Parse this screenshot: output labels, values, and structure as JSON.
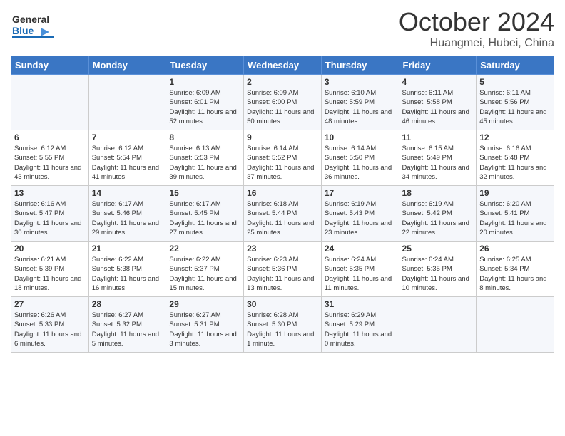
{
  "header": {
    "logo_general": "General",
    "logo_blue": "Blue",
    "month_title": "October 2024",
    "location": "Huangmei, Hubei, China"
  },
  "weekdays": [
    "Sunday",
    "Monday",
    "Tuesday",
    "Wednesday",
    "Thursday",
    "Friday",
    "Saturday"
  ],
  "weeks": [
    [
      {
        "day": "",
        "sunrise": "",
        "sunset": "",
        "daylight": ""
      },
      {
        "day": "",
        "sunrise": "",
        "sunset": "",
        "daylight": ""
      },
      {
        "day": "1",
        "sunrise": "Sunrise: 6:09 AM",
        "sunset": "Sunset: 6:01 PM",
        "daylight": "Daylight: 11 hours and 52 minutes."
      },
      {
        "day": "2",
        "sunrise": "Sunrise: 6:09 AM",
        "sunset": "Sunset: 6:00 PM",
        "daylight": "Daylight: 11 hours and 50 minutes."
      },
      {
        "day": "3",
        "sunrise": "Sunrise: 6:10 AM",
        "sunset": "Sunset: 5:59 PM",
        "daylight": "Daylight: 11 hours and 48 minutes."
      },
      {
        "day": "4",
        "sunrise": "Sunrise: 6:11 AM",
        "sunset": "Sunset: 5:58 PM",
        "daylight": "Daylight: 11 hours and 46 minutes."
      },
      {
        "day": "5",
        "sunrise": "Sunrise: 6:11 AM",
        "sunset": "Sunset: 5:56 PM",
        "daylight": "Daylight: 11 hours and 45 minutes."
      }
    ],
    [
      {
        "day": "6",
        "sunrise": "Sunrise: 6:12 AM",
        "sunset": "Sunset: 5:55 PM",
        "daylight": "Daylight: 11 hours and 43 minutes."
      },
      {
        "day": "7",
        "sunrise": "Sunrise: 6:12 AM",
        "sunset": "Sunset: 5:54 PM",
        "daylight": "Daylight: 11 hours and 41 minutes."
      },
      {
        "day": "8",
        "sunrise": "Sunrise: 6:13 AM",
        "sunset": "Sunset: 5:53 PM",
        "daylight": "Daylight: 11 hours and 39 minutes."
      },
      {
        "day": "9",
        "sunrise": "Sunrise: 6:14 AM",
        "sunset": "Sunset: 5:52 PM",
        "daylight": "Daylight: 11 hours and 37 minutes."
      },
      {
        "day": "10",
        "sunrise": "Sunrise: 6:14 AM",
        "sunset": "Sunset: 5:50 PM",
        "daylight": "Daylight: 11 hours and 36 minutes."
      },
      {
        "day": "11",
        "sunrise": "Sunrise: 6:15 AM",
        "sunset": "Sunset: 5:49 PM",
        "daylight": "Daylight: 11 hours and 34 minutes."
      },
      {
        "day": "12",
        "sunrise": "Sunrise: 6:16 AM",
        "sunset": "Sunset: 5:48 PM",
        "daylight": "Daylight: 11 hours and 32 minutes."
      }
    ],
    [
      {
        "day": "13",
        "sunrise": "Sunrise: 6:16 AM",
        "sunset": "Sunset: 5:47 PM",
        "daylight": "Daylight: 11 hours and 30 minutes."
      },
      {
        "day": "14",
        "sunrise": "Sunrise: 6:17 AM",
        "sunset": "Sunset: 5:46 PM",
        "daylight": "Daylight: 11 hours and 29 minutes."
      },
      {
        "day": "15",
        "sunrise": "Sunrise: 6:17 AM",
        "sunset": "Sunset: 5:45 PM",
        "daylight": "Daylight: 11 hours and 27 minutes."
      },
      {
        "day": "16",
        "sunrise": "Sunrise: 6:18 AM",
        "sunset": "Sunset: 5:44 PM",
        "daylight": "Daylight: 11 hours and 25 minutes."
      },
      {
        "day": "17",
        "sunrise": "Sunrise: 6:19 AM",
        "sunset": "Sunset: 5:43 PM",
        "daylight": "Daylight: 11 hours and 23 minutes."
      },
      {
        "day": "18",
        "sunrise": "Sunrise: 6:19 AM",
        "sunset": "Sunset: 5:42 PM",
        "daylight": "Daylight: 11 hours and 22 minutes."
      },
      {
        "day": "19",
        "sunrise": "Sunrise: 6:20 AM",
        "sunset": "Sunset: 5:41 PM",
        "daylight": "Daylight: 11 hours and 20 minutes."
      }
    ],
    [
      {
        "day": "20",
        "sunrise": "Sunrise: 6:21 AM",
        "sunset": "Sunset: 5:39 PM",
        "daylight": "Daylight: 11 hours and 18 minutes."
      },
      {
        "day": "21",
        "sunrise": "Sunrise: 6:22 AM",
        "sunset": "Sunset: 5:38 PM",
        "daylight": "Daylight: 11 hours and 16 minutes."
      },
      {
        "day": "22",
        "sunrise": "Sunrise: 6:22 AM",
        "sunset": "Sunset: 5:37 PM",
        "daylight": "Daylight: 11 hours and 15 minutes."
      },
      {
        "day": "23",
        "sunrise": "Sunrise: 6:23 AM",
        "sunset": "Sunset: 5:36 PM",
        "daylight": "Daylight: 11 hours and 13 minutes."
      },
      {
        "day": "24",
        "sunrise": "Sunrise: 6:24 AM",
        "sunset": "Sunset: 5:35 PM",
        "daylight": "Daylight: 11 hours and 11 minutes."
      },
      {
        "day": "25",
        "sunrise": "Sunrise: 6:24 AM",
        "sunset": "Sunset: 5:35 PM",
        "daylight": "Daylight: 11 hours and 10 minutes."
      },
      {
        "day": "26",
        "sunrise": "Sunrise: 6:25 AM",
        "sunset": "Sunset: 5:34 PM",
        "daylight": "Daylight: 11 hours and 8 minutes."
      }
    ],
    [
      {
        "day": "27",
        "sunrise": "Sunrise: 6:26 AM",
        "sunset": "Sunset: 5:33 PM",
        "daylight": "Daylight: 11 hours and 6 minutes."
      },
      {
        "day": "28",
        "sunrise": "Sunrise: 6:27 AM",
        "sunset": "Sunset: 5:32 PM",
        "daylight": "Daylight: 11 hours and 5 minutes."
      },
      {
        "day": "29",
        "sunrise": "Sunrise: 6:27 AM",
        "sunset": "Sunset: 5:31 PM",
        "daylight": "Daylight: 11 hours and 3 minutes."
      },
      {
        "day": "30",
        "sunrise": "Sunrise: 6:28 AM",
        "sunset": "Sunset: 5:30 PM",
        "daylight": "Daylight: 11 hours and 1 minute."
      },
      {
        "day": "31",
        "sunrise": "Sunrise: 6:29 AM",
        "sunset": "Sunset: 5:29 PM",
        "daylight": "Daylight: 11 hours and 0 minutes."
      },
      {
        "day": "",
        "sunrise": "",
        "sunset": "",
        "daylight": ""
      },
      {
        "day": "",
        "sunrise": "",
        "sunset": "",
        "daylight": ""
      }
    ]
  ]
}
